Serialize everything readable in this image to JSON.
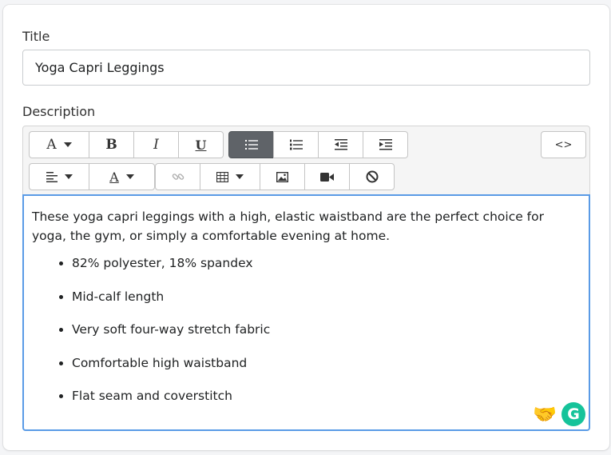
{
  "title_field": {
    "label": "Title",
    "value": "Yoga Capri Leggings"
  },
  "description_field": {
    "label": "Description"
  },
  "toolbar": {
    "font_button_glyph": "A",
    "bold_glyph": "B",
    "italic_glyph": "I",
    "underline_glyph": "U",
    "code_view_glyph": "<>",
    "text_color_glyph": "A"
  },
  "editor": {
    "paragraph": "These yoga capri leggings with a high, elastic waistband are the perfect choice for yoga, the gym, or simply a comfortable evening at home.",
    "bullets": [
      "82% polyester, 18% spandex",
      "Mid-calf length",
      "Very soft four-way stretch fabric",
      "Comfortable high waistband",
      "Flat seam and coverstitch"
    ]
  },
  "badges": {
    "grammarly_glyph": "G",
    "handshake_glyph": "🤝"
  },
  "colors": {
    "editor_focus_border": "#5a9be6",
    "active_button": "#5f6368",
    "grammarly_green": "#15c39a"
  }
}
